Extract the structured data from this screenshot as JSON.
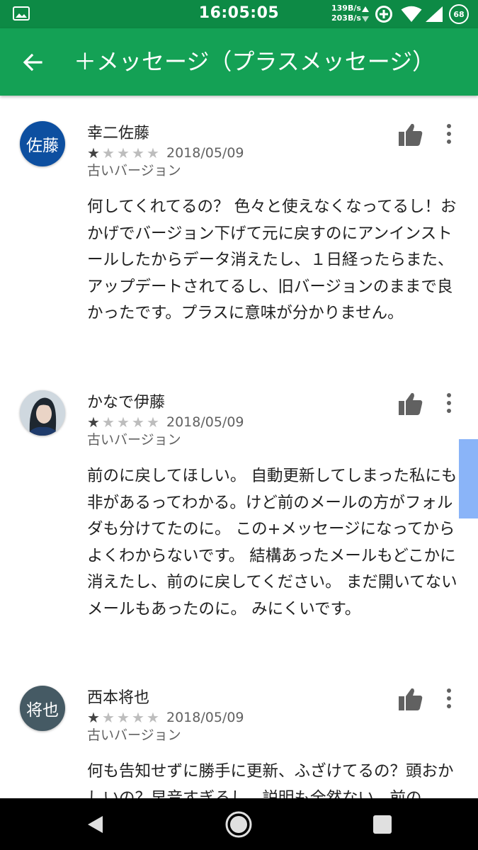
{
  "status_bar": {
    "time": "16:05:05",
    "speed_up": "139B/s",
    "speed_down": "203B/s",
    "battery": "68",
    "icons": [
      "gallery-icon",
      "data-arrows-icon",
      "data-saver-icon",
      "wifi-icon",
      "signal-icon",
      "battery-icon"
    ]
  },
  "app_bar": {
    "title": "＋メッセージ（プラスメッセージ）",
    "back_icon": "arrow-back-icon",
    "color": "#14a155"
  },
  "reviews": [
    {
      "name": "幸二佐藤",
      "avatar_text": "佐藤",
      "avatar_color": "#0d4fa0",
      "rating": 1,
      "date": "2018/05/09",
      "version": "古いバージョン",
      "text": "何してくれてるの？ 色々と使えなくなってるし！おかげでバージョン下げて元に戻すのにアンインストールしたからデータ消えたし、１日経ったらまた、アップデートされてるし、旧バージョンのままで良かったです。プラスに意味が分かりません。"
    },
    {
      "name": "かなで伊藤",
      "avatar_text": "",
      "avatar_color": "#cdd6dd",
      "rating": 1,
      "date": "2018/05/09",
      "version": "古いバージョン",
      "text": "前のに戻してほしい。 自動更新してしまった私にも非があるってわかる。けど前のメールの方がフォルダも分けてたのに。 この+メッセージになってから よくわからないです。 結構あったメールもどこかに消えたし、前のに戻してください。 まだ開いてないメールもあったのに。 みにくいです。"
    },
    {
      "name": "西本将也",
      "avatar_text": "将也",
      "avatar_color": "#455a64",
      "rating": 1,
      "date": "2018/05/09",
      "version": "古いバージョン",
      "text": "何も告知せずに勝手に更新、ふざけてるの？頭おかしいの？早音すぎるし、説明も全然ない、前の"
    }
  ],
  "nav_bar": {
    "icons": [
      "back-triangle-icon",
      "home-circle-icon",
      "recents-square-icon"
    ]
  }
}
